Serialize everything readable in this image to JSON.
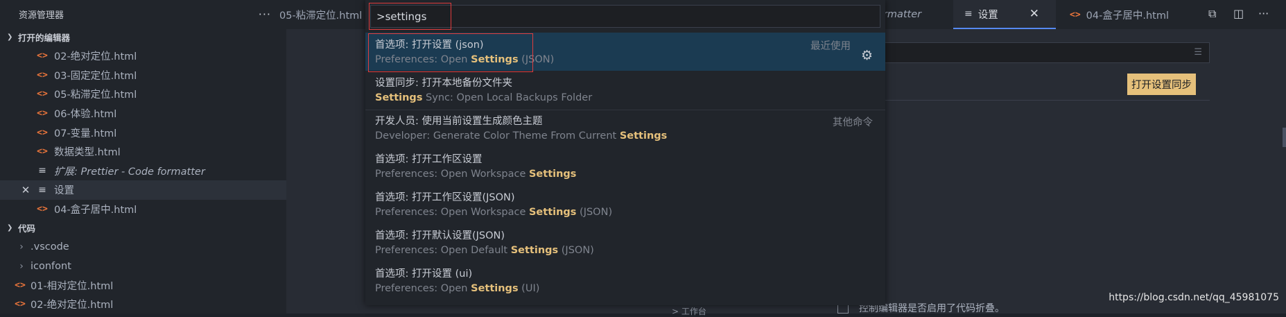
{
  "sidebar": {
    "title": "资源管理器",
    "more": "···",
    "open_editors_label": "打开的编辑器",
    "open_editors": [
      {
        "name": "02-绝对定位.html",
        "type": "html"
      },
      {
        "name": "03-固定定位.html",
        "type": "html"
      },
      {
        "name": "05-粘滞定位.html",
        "type": "html"
      },
      {
        "name": "06-体验.html",
        "type": "html"
      },
      {
        "name": "07-变量.html",
        "type": "html"
      },
      {
        "name": "数据类型.html",
        "type": "html"
      },
      {
        "name": "扩展: Prettier - Code formatter",
        "type": "lines"
      },
      {
        "name": "设置",
        "type": "lines"
      },
      {
        "name": "04-盒子居中.html",
        "type": "html"
      }
    ],
    "folder_label": "代码",
    "folder_items": [
      {
        "name": ".vscode",
        "type": "folder"
      },
      {
        "name": "iconfont",
        "type": "folder"
      },
      {
        "name": "01-相对定位.html",
        "type": "html"
      },
      {
        "name": "02-绝对定位.html",
        "type": "html"
      }
    ]
  },
  "tabs": {
    "left_partial": "05-粘滞定位.html",
    "formatter_partial": "ormatter",
    "settings": "设置",
    "box_center": "04-盒子居中.html"
  },
  "settings_page": {
    "sync_button": "打开设置同步",
    "bottom_left": "> 工作台",
    "bottom_text": "控制编辑器是否启用了代码折叠。"
  },
  "palette": {
    "query": ">settings",
    "items": [
      {
        "title": "首选项: 打开设置 (json)",
        "pre": "Preferences: Open ",
        "hl": "Settings",
        "post": " (JSON)",
        "meta": "最近使用",
        "selected": true
      },
      {
        "title": "设置同步: 打开本地备份文件夹",
        "pre": "",
        "hl": "Settings",
        "post": " Sync: Open Local Backups Folder",
        "meta": ""
      },
      {
        "title": "开发人员: 使用当前设置生成颜色主题",
        "pre": "Developer: Generate Color Theme From Current ",
        "hl": "Settings",
        "post": "",
        "meta": "其他命令"
      },
      {
        "title": "首选项: 打开工作区设置",
        "pre": "Preferences: Open Workspace ",
        "hl": "Settings",
        "post": "",
        "meta": ""
      },
      {
        "title": "首选项: 打开工作区设置(JSON)",
        "pre": "Preferences: Open Workspace ",
        "hl": "Settings",
        "post": " (JSON)",
        "meta": ""
      },
      {
        "title": "首选项: 打开默认设置(JSON)",
        "pre": "Preferences: Open Default ",
        "hl": "Settings",
        "post": " (JSON)",
        "meta": ""
      },
      {
        "title": "首选项: 打开设置 (ui)",
        "pre": "Preferences: Open ",
        "hl": "Settings",
        "post": " (UI)",
        "meta": ""
      }
    ]
  },
  "watermark": "https://blog.csdn.net/qq_45981075"
}
